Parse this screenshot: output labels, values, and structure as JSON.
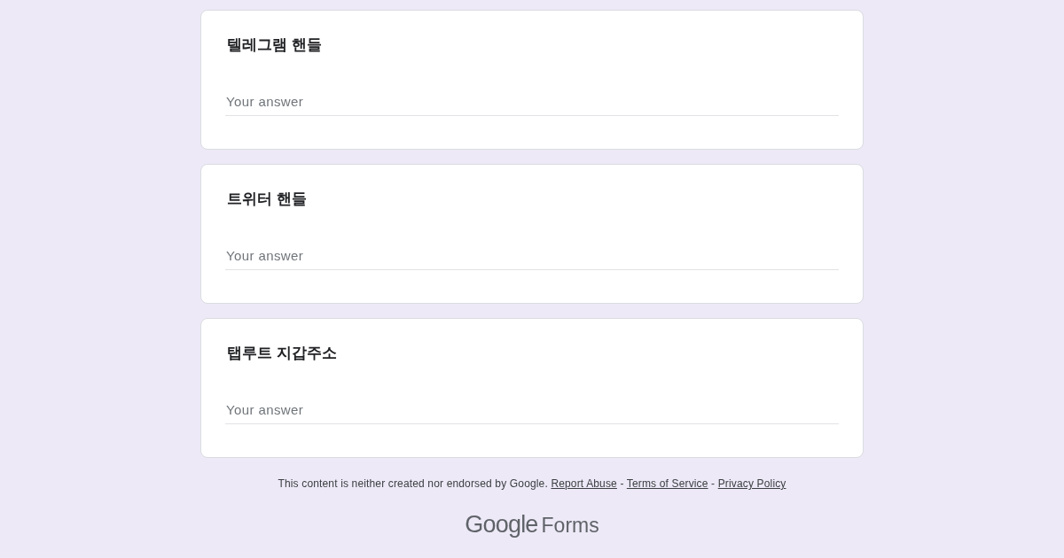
{
  "questions": [
    {
      "title": "텔레그램 핸들",
      "placeholder": "Your answer"
    },
    {
      "title": "트위터 핸들",
      "placeholder": "Your answer"
    },
    {
      "title": "탭루트 지갑주소",
      "placeholder": "Your answer"
    }
  ],
  "footer": {
    "disclaimer": "This content is neither created nor endorsed by Google.",
    "links": [
      "Report Abuse",
      "Terms of Service",
      "Privacy Policy"
    ],
    "separator": "-"
  },
  "logo": {
    "brand": "Google",
    "product": "Forms"
  }
}
